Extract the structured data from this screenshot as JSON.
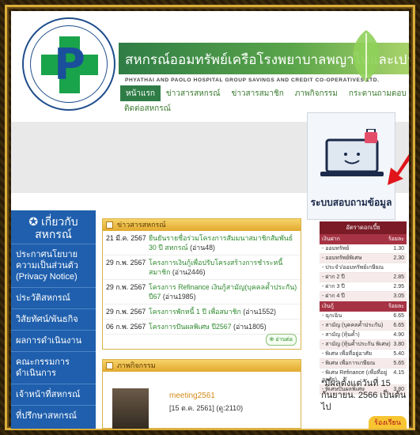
{
  "header": {
    "title_th": "สหกรณ์ออมทรัพย์เครือโรงพยาบาลพญาไทและเปาโล จำกัด",
    "title_en": "PHYATHAI AND PAOLO HOSPITAL GROUP SAVINGS AND CREDIT CO-OPERATIVES LTD.",
    "nav": [
      "หน้าแรก",
      "ข่าวสารสหกรณ์",
      "ข่าวสารสมาชิก",
      "ภาพกิจกรรม",
      "กระดานถามตอบ"
    ],
    "nav2": "ติดต่อสหกรณ์"
  },
  "promo": {
    "label": "ระบบสอบถามข้อมูล"
  },
  "sidebar": {
    "heading": "เกี่ยวกับสหกรณ์",
    "items": [
      "ประกาศนโยบายความเป็นส่วนตัว (Privacy Notice)",
      "ประวัติสหกรณ์",
      "วิสัยทัศน์/พันธกิจ",
      "ผลการดำเนินงาน",
      "คณะกรรมการดำเนินการ",
      "เจ้าหน้าที่สหกรณ์",
      "ที่ปรึกษาสหกรณ์"
    ]
  },
  "news": {
    "heading": "ข่าวสารสหกรณ์",
    "rows": [
      {
        "date": "21 มี.ค. 2567",
        "title": "ยืนยันรายชื่อร่วมโครงการสัมมนาสมาชิกสัมพันธ์ 30 ปี สหกรณ์",
        "count": "(อ่าน48)"
      },
      {
        "date": "29 ก.พ. 2567",
        "title": "โครงการเงินกู้เพื่อปรับโครงสร้างการชำระหนี้สมาชิก",
        "count": "(อ่าน2446)"
      },
      {
        "date": "29 ก.พ. 2567",
        "title": "โครงการ Refinance เงินกู้สามัญ(บุคคลค้ำประกัน) ปี67",
        "count": "(อ่าน1985)"
      },
      {
        "date": "29 ก.พ. 2567",
        "title": "โครงการพักหนี้ 1 ปี เพื่อสมาชิก",
        "count": "(อ่าน1552)"
      },
      {
        "date": "06 ก.พ. 2567",
        "title": "โครงการปันผลพิเศษ ปี2567",
        "count": "(อ่าน1805)"
      }
    ],
    "more": "อ่านต่อ"
  },
  "activity": {
    "heading": "ภาพกิจกรรม",
    "title": "meeting2561",
    "date": "[15 ต.ค. 2561] (ดู:2110)"
  },
  "rates": {
    "title": "อัตราดอกเบี้ย",
    "deposit_header": [
      "เงินฝาก",
      "ร้อยละ"
    ],
    "deposit": [
      {
        "label": "- ออมทรัพย์",
        "value": "1.30"
      },
      {
        "label": "- ออมทรัพย์พิเศษ",
        "value": "2.30"
      },
      {
        "label": "- ประจำ/ออมทรัพย์เกษียณ",
        "value": ""
      },
      {
        "label": "  - ฝาก 2 ปี",
        "value": "2.85"
      },
      {
        "label": "  - ฝาก 3 ปี",
        "value": "2.95"
      },
      {
        "label": "  - ฝาก 4 ปี",
        "value": "3.05"
      }
    ],
    "loan_header": [
      "เงินกู้",
      "ร้อยละ"
    ],
    "loan": [
      {
        "label": "- ฉุกเฉิน",
        "value": "6.65"
      },
      {
        "label": "- สามัญ (บุคคลค้ำประกัน)",
        "value": "6.65"
      },
      {
        "label": "- สามัญ (หุ้นค้ำ)",
        "value": "4.90"
      },
      {
        "label": "- สามัญ (หุ้นค้ำประกัน พิเศษ)",
        "value": "3.80"
      },
      {
        "label": "- พิเศษ เพื่อที่อยู่อาศัย",
        "value": "5.40"
      },
      {
        "label": "- พิเศษ เพื่อการเกษียณ",
        "value": "5.65"
      },
      {
        "label": "- พิเศษ Refinance (เพื่อที่อยู่อาศัย)",
        "value": "4.15"
      },
      {
        "label": "- พิเศษปันผลพิเศษ",
        "value": "3.80"
      }
    ]
  },
  "notice": "*มีผลตั้งแต่วันที่ 15 กันยายน. 2566 เป็นต้นไป",
  "badge": "ร้องเรียน",
  "colors": {
    "brand_green": "#2f7d46",
    "sidebar_blue": "#1f5fad",
    "frame_gold": "#d9ad3a",
    "rate_header": "#7a1b26"
  }
}
